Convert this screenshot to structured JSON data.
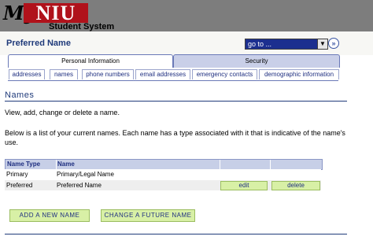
{
  "header": {
    "logo_my": "My",
    "logo_niu": "NIU",
    "logo_sub": "Student System"
  },
  "page": {
    "title": "Preferred Name",
    "goto_label": "go to ...",
    "go_symbol": "»"
  },
  "tabs": [
    {
      "label": "Personal Information",
      "active": true
    },
    {
      "label": "Security",
      "active": false
    }
  ],
  "subtabs": [
    {
      "label": "addresses"
    },
    {
      "label": "names"
    },
    {
      "label": "phone numbers"
    },
    {
      "label": "email addresses"
    },
    {
      "label": "emergency contacts"
    },
    {
      "label": "demographic information"
    }
  ],
  "section": {
    "heading": "Names",
    "instructions": "View, add, change or delete a name.",
    "description": "Below is a list of your current names. Each name has a type associated with it that is indicative of the name's use."
  },
  "table": {
    "headers": [
      "Name Type",
      "Name",
      "",
      ""
    ],
    "rows": [
      {
        "type": "Primary",
        "name": "Primary/Legal Name"
      },
      {
        "type": "Preferred",
        "name": "Preferred Name",
        "edit": "edit",
        "delete": "delete"
      }
    ]
  },
  "actions": {
    "add": "ADD A NEW NAME",
    "change": "CHANGE A FUTURE NAME"
  },
  "colors": {
    "header_bg": "#7d7d7d",
    "brand_red": "#b0121b",
    "link_blue": "#1f3a7a",
    "button_green": "#d8f0a6"
  }
}
